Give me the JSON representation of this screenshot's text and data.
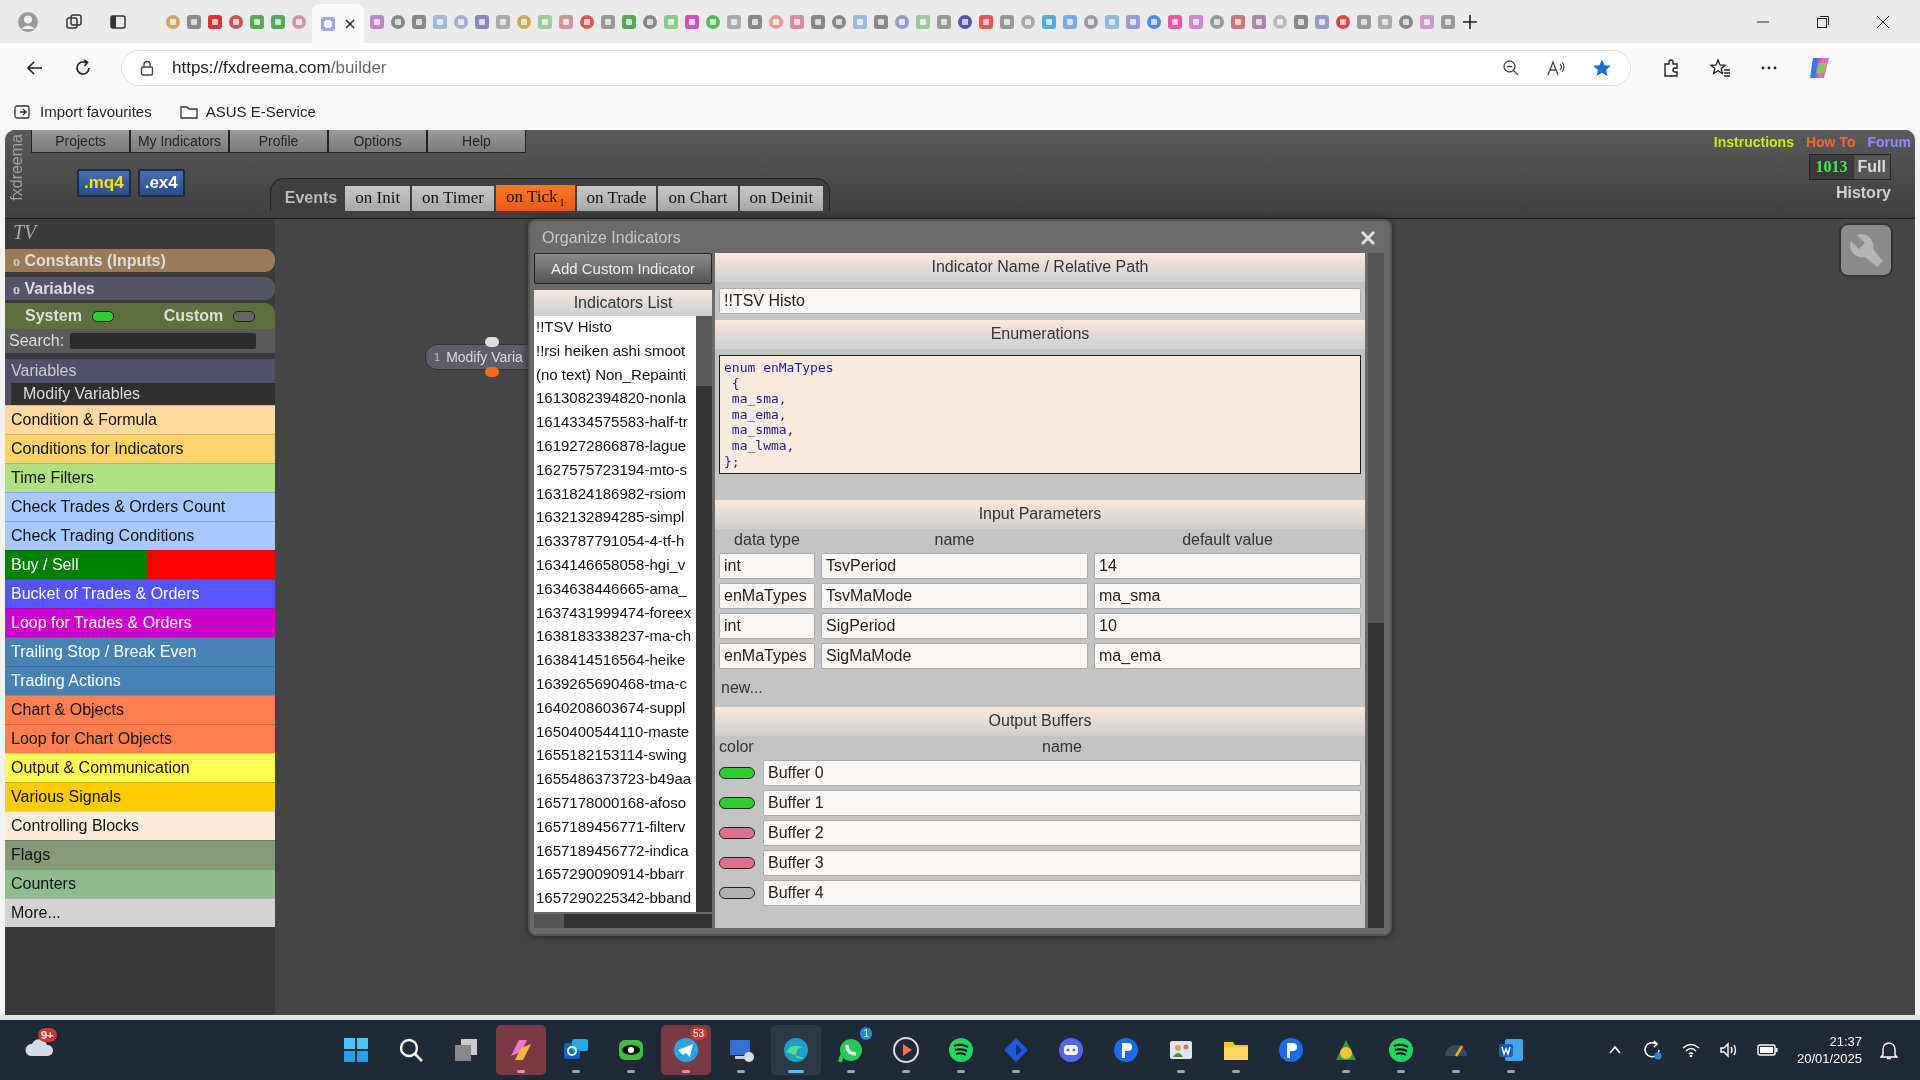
{
  "browser": {
    "url_host": "https://fxdreema.com",
    "url_path": "/builder",
    "bookmarks": [
      "Import favourites",
      "ASUS E-Service"
    ]
  },
  "app": {
    "logo": "fxdreema",
    "menu": [
      "Projects",
      "My Indicators",
      "Profile",
      "Options",
      "Help"
    ],
    "file_buttons": [
      ".mq4",
      ".ex4"
    ],
    "top_links": [
      {
        "label": "Instructions",
        "color": "#c8f000"
      },
      {
        "label": "How To",
        "color": "#ff6633"
      },
      {
        "label": "Forum",
        "color": "#8c8cff"
      }
    ],
    "counter": "1013",
    "mode": "Full",
    "history": "History"
  },
  "events": {
    "label": "Events",
    "tabs": [
      {
        "label": "on Init",
        "selected": false
      },
      {
        "label": "on Timer",
        "selected": false
      },
      {
        "label": "on Tick",
        "selected": true,
        "badge": "1"
      },
      {
        "label": "on Trade",
        "selected": false
      },
      {
        "label": "on Chart",
        "selected": false
      },
      {
        "label": "on Deinit",
        "selected": false
      }
    ]
  },
  "sidebar": {
    "project": "TV",
    "sections": [
      {
        "marker": "o",
        "label": "Constants (Inputs)",
        "color": "#9b7a58"
      },
      {
        "marker": "o",
        "label": "Variables",
        "color": "#545468"
      }
    ],
    "toggles": [
      {
        "label": "System",
        "on": true
      },
      {
        "label": "Custom",
        "on": false
      }
    ],
    "search_label": "Search:",
    "group": "Variables",
    "group_items": [
      "Modify Variables"
    ],
    "categories": [
      {
        "label": "Condition & Formula",
        "color": "#ffd9a0"
      },
      {
        "label": "Conditions for Indicators",
        "color": "#ffd36b"
      },
      {
        "label": "Time Filters",
        "color": "#b0e080"
      },
      {
        "label": "Check Trades & Orders Count",
        "color": "#a8c8ff"
      },
      {
        "label": "Check Trading Conditions",
        "color": "#a8c8ff"
      },
      {
        "label": "Buy / Sell",
        "color": "#008000",
        "split": {
          "color": "#ff0000"
        }
      },
      {
        "label": "Bucket of Trades & Orders",
        "color": "#5555ff"
      },
      {
        "label": "Loop for Trades & Orders",
        "color": "#cc00cc"
      },
      {
        "label": "Trailing Stop / Break Even",
        "color": "#4682b4"
      },
      {
        "label": "Trading Actions",
        "color": "#4682b4"
      },
      {
        "label": "Chart & Objects",
        "color": "#ff7f50"
      },
      {
        "label": "Loop for Chart Objects",
        "color": "#ff7f50"
      },
      {
        "label": "Output & Communication",
        "color": "#ffff55"
      },
      {
        "label": "Various Signals",
        "color": "#ffcc00"
      },
      {
        "label": "Controlling Blocks",
        "color": "#ffebdc"
      },
      {
        "label": "Flags",
        "color": "#889977"
      },
      {
        "label": "Counters",
        "color": "#8fbc8f"
      },
      {
        "label": "More...",
        "color": "#d3d3d3"
      }
    ]
  },
  "canvas_blocks": [
    {
      "number": "1",
      "label": "Modify Varia"
    }
  ],
  "dialog": {
    "title": "Organize Indicators",
    "add_button": "Add Custom Indicator",
    "list_title": "Indicators List",
    "indicators": [
      "!!TSV Histo",
      "!!rsi heiken ashi smoot",
      "(no text) Non_Repainti",
      "1613082394820-nonla",
      "1614334575583-half-tr",
      "1619272866878-lague",
      "1627575723194-mto-s",
      "1631824186982-rsiom",
      "1632132894285-simpl",
      "1633787791054-4-tf-h",
      "1634146658058-hgi_v",
      "1634638446665-ama_",
      "1637431999474-foreex",
      "1638183338237-ma-ch",
      "1638414516564-heike",
      "1639265690468-tma-c",
      "1640208603674-suppl",
      "1650400544110-maste",
      "1655182153114-swing",
      "1655486373723-b49aa",
      "1657178000168-afoso",
      "1657189456771-filterv",
      "1657189456772-indica",
      "1657290090914-bbarr",
      "1657290225342-bband"
    ],
    "name_title": "Indicator Name / Relative Path",
    "name_value": "!!TSV Histo",
    "enum_title": "Enumerations",
    "enum_code": "enum enMaTypes\n {\n ma_sma,\n ma_ema,\n ma_smma,\n ma_lwma,\n};",
    "inputs_title": "Input Parameters",
    "input_columns": [
      "data type",
      "name",
      "default value"
    ],
    "inputs": [
      {
        "type": "int",
        "name": "TsvPeriod",
        "default": "14"
      },
      {
        "type": "enMaTypes",
        "name": "TsvMaMode",
        "default": "ma_sma"
      },
      {
        "type": "int",
        "name": "SigPeriod",
        "default": "10"
      },
      {
        "type": "enMaTypes",
        "name": "SigMaMode",
        "default": "ma_ema"
      }
    ],
    "new_link": "new...",
    "buffers_title": "Output Buffers",
    "buffer_columns": [
      "color",
      "name"
    ],
    "buffers": [
      {
        "color": "#33cc33",
        "name": "Buffer 0"
      },
      {
        "color": "#33cc33",
        "name": "Buffer 1"
      },
      {
        "color": "#e07090",
        "name": "Buffer 2"
      },
      {
        "color": "#e07090",
        "name": "Buffer 3"
      },
      {
        "color": "#b0b0b0",
        "name": "Buffer 4"
      }
    ]
  },
  "taskbar": {
    "weather_badge": "9+",
    "apps": [
      {
        "kind": "start",
        "open": false,
        "alert": false,
        "active": false
      },
      {
        "kind": "search",
        "open": false,
        "alert": false,
        "active": false
      },
      {
        "kind": "windows",
        "open": false,
        "alert": false,
        "active": false
      },
      {
        "kind": "swirl",
        "open": true,
        "alert": true,
        "active": false
      },
      {
        "kind": "mail",
        "open": true,
        "alert": false,
        "active": false
      },
      {
        "kind": "eye",
        "open": true,
        "alert": false,
        "active": false
      },
      {
        "kind": "plane",
        "open": true,
        "alert": true,
        "active": false,
        "badge": "53"
      },
      {
        "kind": "monitor",
        "open": true,
        "alert": false,
        "active": false
      },
      {
        "kind": "wave",
        "open": true,
        "alert": false,
        "active": true
      },
      {
        "kind": "phone",
        "open": true,
        "alert": false,
        "active": false,
        "badge": "1"
      },
      {
        "kind": "play",
        "open": true,
        "alert": false,
        "active": false
      },
      {
        "kind": "stripes",
        "open": true,
        "alert": false,
        "active": false
      },
      {
        "kind": "diamond",
        "open": true,
        "alert": false,
        "active": false
      },
      {
        "kind": "controller",
        "open": false,
        "alert": false,
        "active": false
      },
      {
        "kind": "pin",
        "open": false,
        "alert": false,
        "active": false
      },
      {
        "kind": "people",
        "open": true,
        "alert": false,
        "active": false
      },
      {
        "kind": "folder",
        "open": true,
        "alert": false,
        "active": false
      },
      {
        "kind": "pin",
        "open": false,
        "alert": false,
        "active": false
      },
      {
        "kind": "coins",
        "open": true,
        "alert": false,
        "active": false
      },
      {
        "kind": "stripes",
        "open": true,
        "alert": false,
        "active": false
      },
      {
        "kind": "gauge",
        "open": true,
        "alert": false,
        "active": false
      },
      {
        "kind": "document",
        "open": true,
        "alert": false,
        "active": false
      }
    ],
    "time": "21:37",
    "date": "20/01/2025"
  }
}
